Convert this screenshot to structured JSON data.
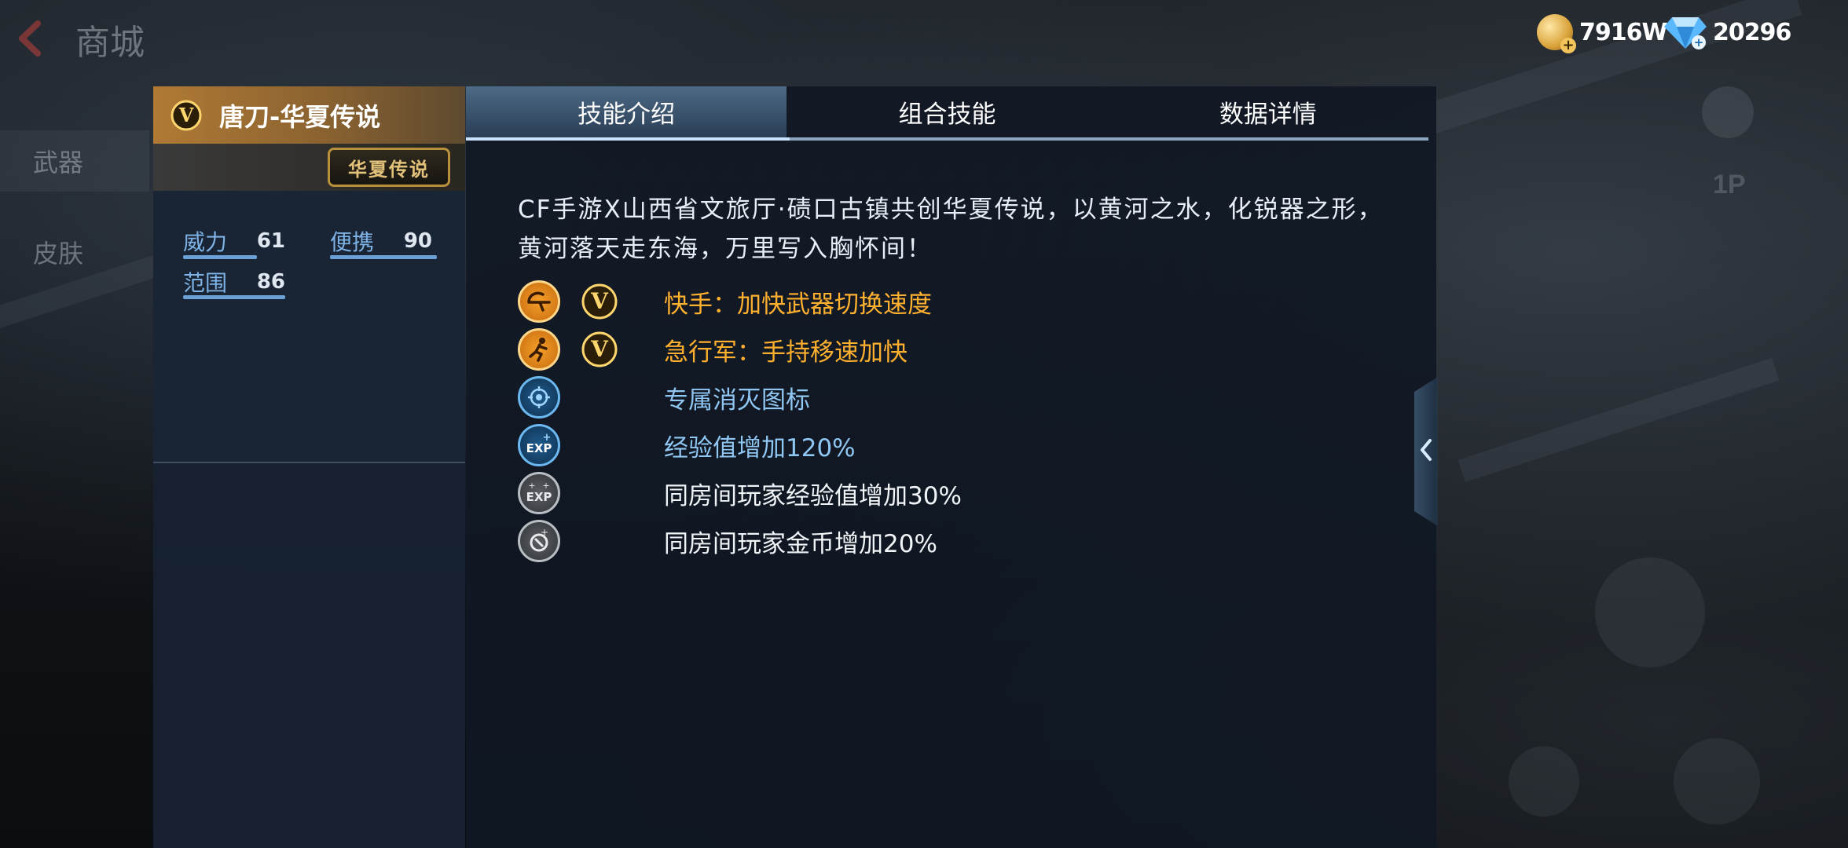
{
  "app": {
    "title": "商城"
  },
  "currency": {
    "gold": {
      "value": "7916W",
      "icon": "gold-coin-icon"
    },
    "diamond": {
      "value": "20296",
      "icon": "diamond-icon"
    }
  },
  "nav": {
    "items": [
      {
        "label": "武器"
      },
      {
        "label": "皮肤"
      }
    ]
  },
  "weapon": {
    "name": "唐刀-华夏传说",
    "emblem": "华夏传说",
    "stats": [
      {
        "label": "威力",
        "value": "61"
      },
      {
        "label": "便携",
        "value": "90"
      },
      {
        "label": "范围",
        "value": "86"
      }
    ]
  },
  "tabs": [
    {
      "label": "技能介绍",
      "active": true
    },
    {
      "label": "组合技能",
      "active": false
    },
    {
      "label": "数据详情",
      "active": false
    }
  ],
  "description": "CF手游X山西省文旅厅·碛口古镇共创华夏传说，以黄河之水，化锐器之形，黄河落天走东海，万里写入胸怀间！",
  "skills": [
    {
      "text": "快手：加快武器切换速度",
      "icon": "quick-hand-icon",
      "color": "#ffb02e",
      "vip": true
    },
    {
      "text": "急行军：手持移速加快",
      "icon": "running-man-icon",
      "color": "#ffb02e",
      "vip": true
    },
    {
      "text": "专属消灭图标",
      "icon": "kill-icon",
      "color": "#8fc6f2",
      "vip": false
    },
    {
      "text": "经验值增加120%",
      "icon": "exp-icon",
      "color": "#8fc6f2",
      "vip": false
    },
    {
      "text": "同房间玩家经验值增加30%",
      "icon": "team-exp-icon",
      "color": "#f2f5f8",
      "vip": false
    },
    {
      "text": "同房间玩家金币增加20%",
      "icon": "team-coin-icon",
      "color": "#f2f5f8",
      "vip": false
    }
  ],
  "vip_badge": "V",
  "background": {
    "label_1p": "1P"
  },
  "colors": {
    "gold_header": "#b07a35",
    "tab_active": "#4d6a86",
    "skill_orange": "#ffb02e",
    "skill_blue": "#8fc6f2",
    "stat_label": "#7fb2e5"
  }
}
